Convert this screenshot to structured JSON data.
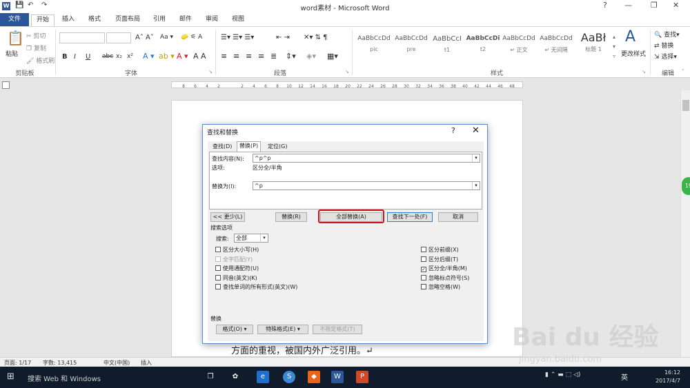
{
  "window": {
    "title": "word素材 - Microsoft Word",
    "minimize_icon": "minimize-icon",
    "maximize_icon": "restore-icon",
    "close_icon": "close-icon"
  },
  "quick_access": {
    "save": "💾",
    "undo": "↶",
    "redo": "↷"
  },
  "tabs": [
    "文件",
    "开始",
    "插入",
    "格式",
    "页面布局",
    "引用",
    "邮件",
    "审阅",
    "视图"
  ],
  "ribbon": {
    "clipboard": {
      "paste": "粘贴",
      "cut": "剪切",
      "copy": "复制",
      "format_painter": "格式刷",
      "label": "剪贴板"
    },
    "font": {
      "label": "字体",
      "bold": "B",
      "italic": "I",
      "underline": "U",
      "strike": "abc",
      "sub": "x₂",
      "sup": "x²"
    },
    "paragraph": {
      "label": "段落"
    },
    "styles": {
      "label": "样式",
      "items": [
        {
          "sample": "AaBbCcDd",
          "name": "pic"
        },
        {
          "sample": "AaBbCcDd",
          "name": "pre"
        },
        {
          "sample": "AaBbCcI",
          "name": "t1"
        },
        {
          "sample": "AaBbCcDi",
          "name": "t2"
        },
        {
          "sample": "AaBbCcDd",
          "name": "↵ 正文"
        },
        {
          "sample": "AaBbCcDd",
          "name": "↵ 无间隔"
        },
        {
          "sample": "AaBł",
          "name": "标题 1"
        }
      ],
      "change_styles": "更改样式"
    },
    "editing": {
      "label": "编辑",
      "find": "查找",
      "replace": "替换",
      "select": "选择"
    }
  },
  "ruler": {
    "ticks": [
      "8",
      "6",
      "4",
      "2",
      "",
      "2",
      "4",
      "6",
      "8",
      "10",
      "12",
      "14",
      "16",
      "18",
      "20",
      "22",
      "24",
      "26",
      "28",
      "30",
      "32",
      "34",
      "36",
      "38",
      "40",
      "42",
      "44",
      "46",
      "48"
    ]
  },
  "document": {
    "visible_line": "方面的重视，被国内外广泛引用。↵"
  },
  "dialog": {
    "title": "查找和替换",
    "help": "?",
    "close": "✕",
    "tabs": [
      "查找(D)",
      "替换(P)",
      "定位(G)"
    ],
    "find_label": "查找内容(N):",
    "find_value": "^p^p",
    "options_label": "选项:",
    "options_value": "区分全/半角",
    "replace_label": "替换为(I):",
    "replace_value": "^p",
    "buttons": {
      "less": "<< 更少(L)",
      "replace": "替换(R)",
      "replace_all": "全部替换(A)",
      "find_next": "查找下一处(F)",
      "cancel": "取消"
    },
    "search_options_label": "搜索选项",
    "search_label": "搜索:",
    "search_value": "全部",
    "left_checks": [
      {
        "label": "区分大小写(H)",
        "checked": false,
        "disabled": false
      },
      {
        "label": "全字匹配(Y)",
        "checked": false,
        "disabled": true
      },
      {
        "label": "使用通配符(U)",
        "checked": false,
        "disabled": false
      },
      {
        "label": "同音(英文)(K)",
        "checked": false,
        "disabled": false
      },
      {
        "label": "查找单词的所有形式(英文)(W)",
        "checked": false,
        "disabled": false
      }
    ],
    "right_checks": [
      {
        "label": "区分前缀(X)",
        "checked": false
      },
      {
        "label": "区分后缀(T)",
        "checked": false
      },
      {
        "label": "区分全/半角(M)",
        "checked": true
      },
      {
        "label": "忽略标点符号(S)",
        "checked": false
      },
      {
        "label": "忽略空格(W)",
        "checked": false
      }
    ],
    "replace_section_label": "替换",
    "format_button": "格式(O) ▾",
    "special_button": "特殊格式(E) ▾",
    "no_format_button": "不限定格式(T)"
  },
  "statusbar": {
    "page": "页面: 1/17",
    "words": "字数: 13,415",
    "lang": "中文(中国)",
    "mode": "插入"
  },
  "taskbar": {
    "search_placeholder": "搜索 Web 和 Windows",
    "time": "16:12",
    "date": "2017/4/7",
    "ime": "英"
  },
  "watermark": {
    "brand": "Bai du 经验",
    "url": "jingyan.baidu.com"
  }
}
